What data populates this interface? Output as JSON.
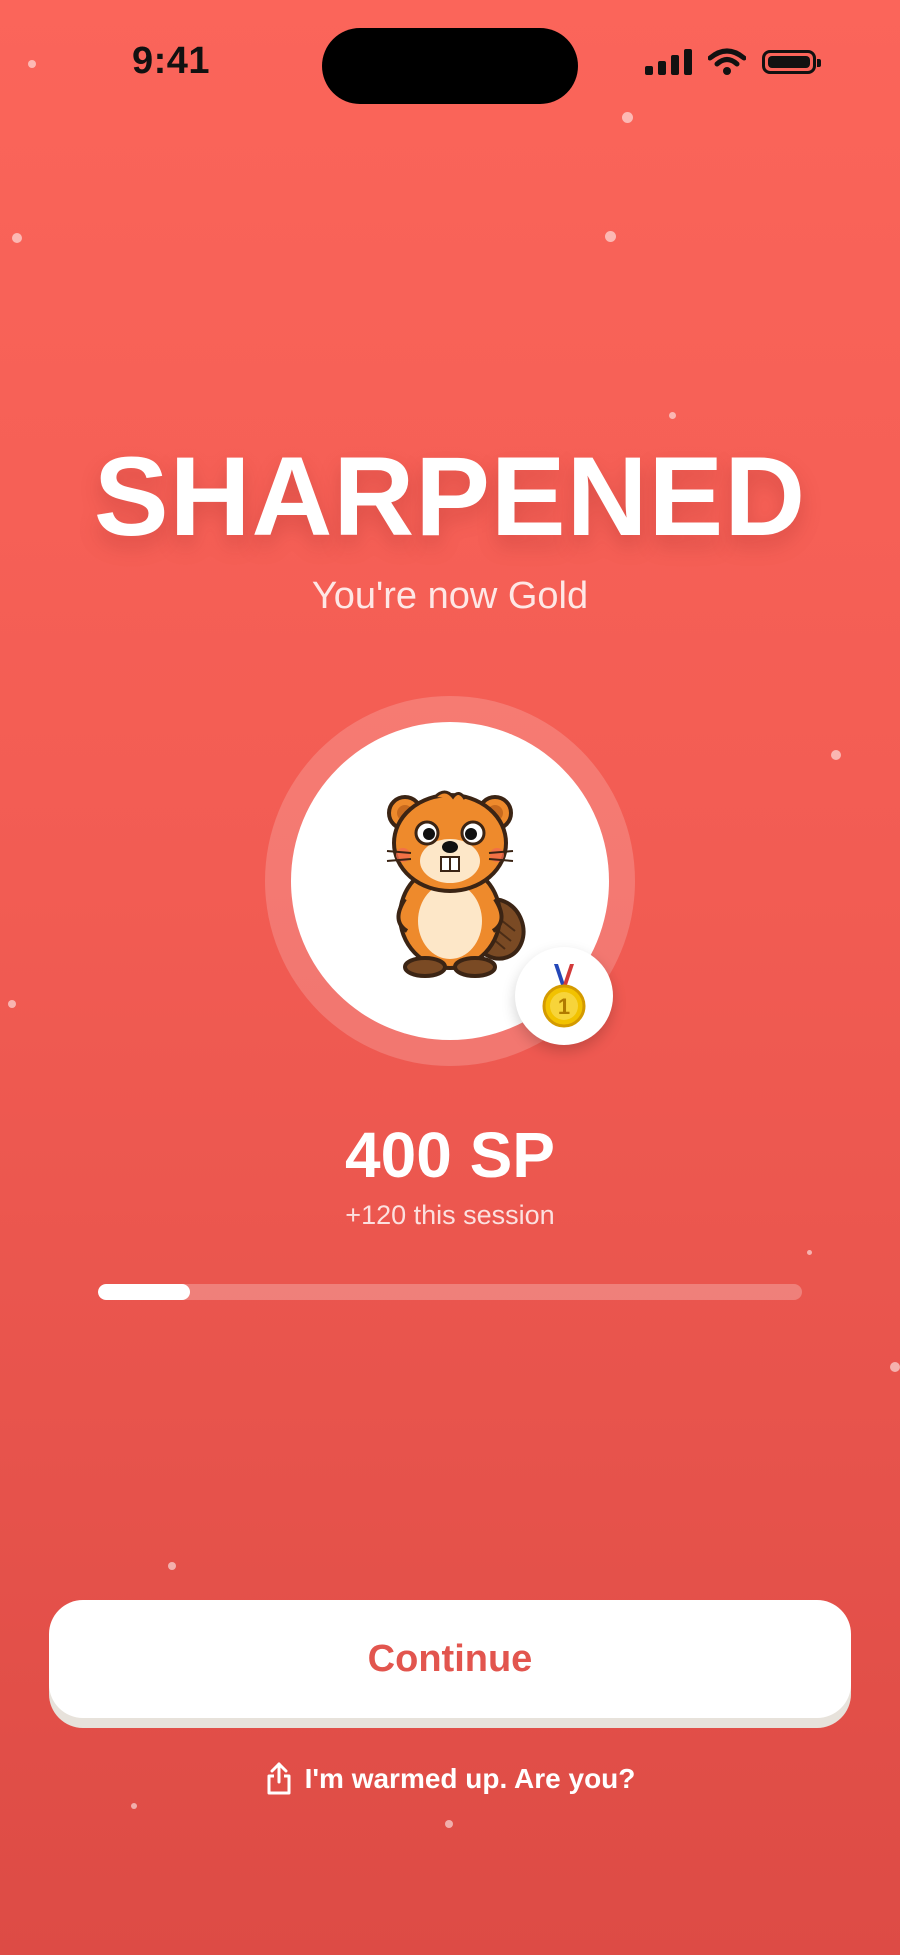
{
  "status_bar": {
    "time": "9:41",
    "icons": [
      "cellular-signal-icon",
      "wifi-icon",
      "battery-icon"
    ]
  },
  "result": {
    "title": "SHARPENED",
    "subtitle": "You're now Gold"
  },
  "avatar": {
    "character": "beaver-mascot",
    "badge_icon": "gold-medal-icon",
    "badge_number": "1"
  },
  "score": {
    "points": "400 SP",
    "session_gain": "+120 this session",
    "progress_fraction": 0.13
  },
  "actions": {
    "continue_label": "Continue",
    "share_label": "I'm warmed up. Are you?",
    "share_icon": "share-icon"
  },
  "colors": {
    "background_top": "#fb655a",
    "background_bottom": "#dd4b45",
    "button_text": "#e2554e",
    "medal_gold": "#f2c200"
  }
}
